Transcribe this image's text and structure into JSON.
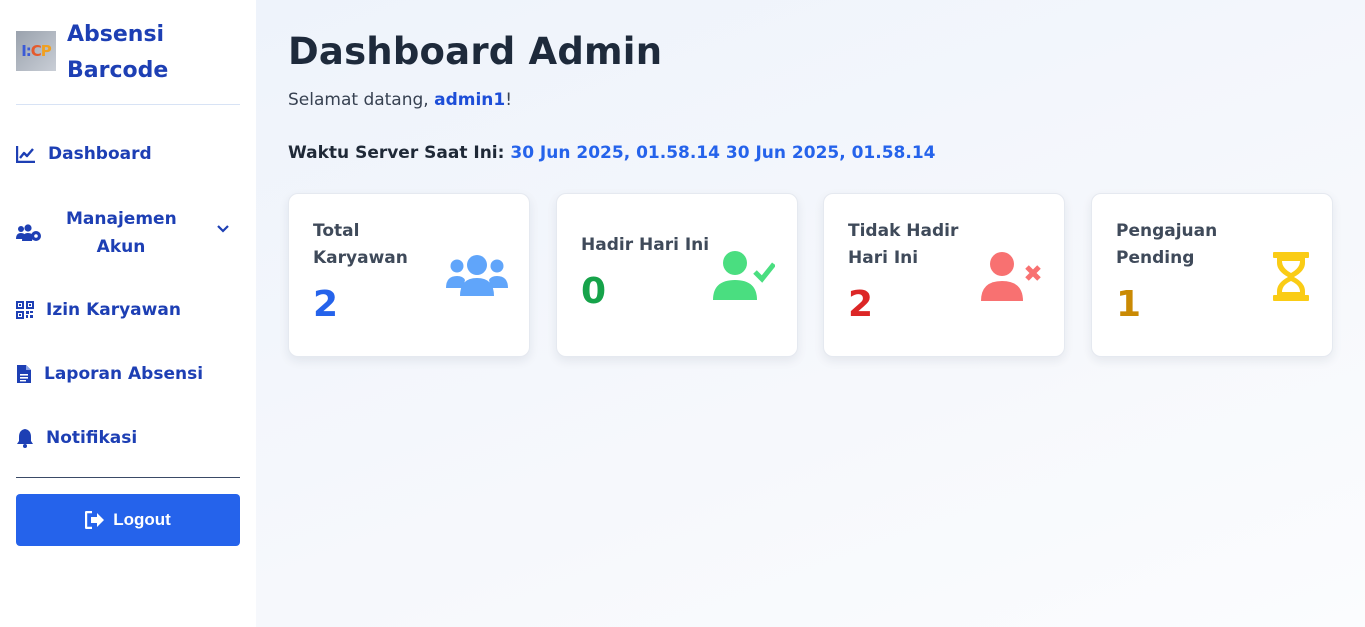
{
  "brand": {
    "logo_text": "I:CP",
    "title": "Absensi Barcode"
  },
  "sidebar": {
    "items": [
      {
        "label": "Dashboard",
        "icon": "chart-line-icon"
      },
      {
        "label": "Manajemen Akun",
        "icon": "users-cog-icon"
      },
      {
        "label": "Izin Karyawan",
        "icon": "qrcode-icon"
      },
      {
        "label": "Laporan Absensi",
        "icon": "file-icon"
      },
      {
        "label": "Notifikasi",
        "icon": "bell-icon"
      }
    ],
    "logout_label": "Logout"
  },
  "header": {
    "title": "Dashboard Admin",
    "welcome_prefix": "Selamat datang, ",
    "username": "admin1",
    "welcome_suffix": "!",
    "server_label": "Waktu Server Saat Ini: ",
    "server_time": "30 Jun 2025, 01.58.14 30 Jun 2025, 01.58.14"
  },
  "cards": [
    {
      "label": "Total Karyawan",
      "value": "2",
      "icon": "users-icon",
      "color": "#2563eb"
    },
    {
      "label": "Hadir Hari Ini",
      "value": "0",
      "icon": "user-check-icon",
      "color": "#16a34a"
    },
    {
      "label": "Tidak Hadir Hari Ini",
      "value": "2",
      "icon": "user-times-icon",
      "color": "#dc2626"
    },
    {
      "label": "Pengajuan Pending",
      "value": "1",
      "icon": "hourglass-icon",
      "color": "#ca8a04"
    }
  ],
  "colors": {
    "brand_blue": "#1d3fb4",
    "accent": "#2563eb"
  }
}
